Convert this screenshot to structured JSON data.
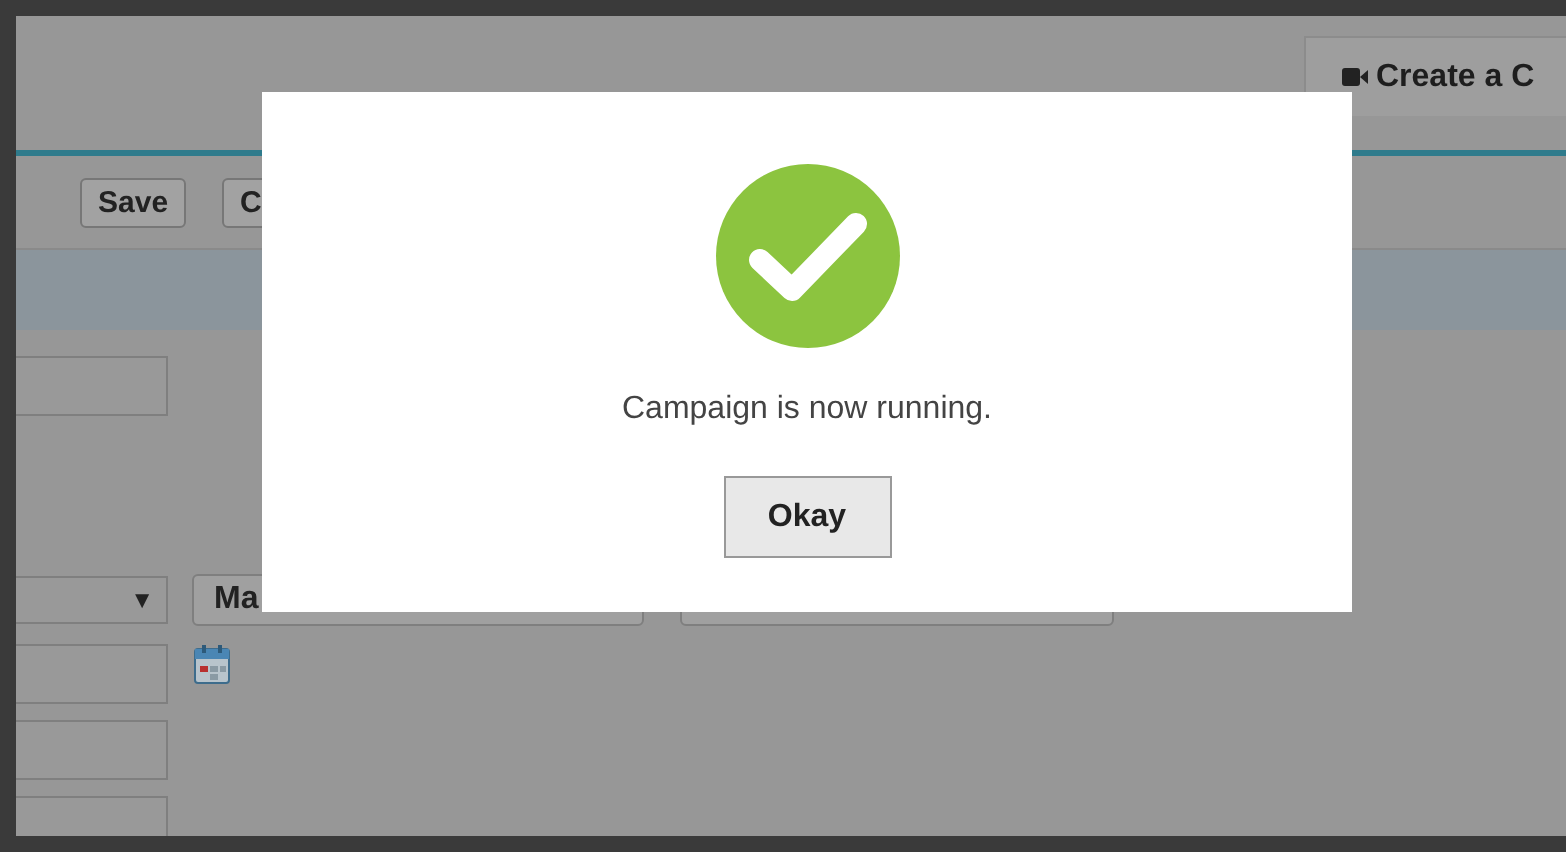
{
  "header": {
    "tab": {
      "label": "Create a C"
    }
  },
  "toolbar": {
    "buttons": [
      "Save",
      "C"
    ]
  },
  "form": {
    "select_arrow": "▼",
    "dropdown_value": "Ma"
  },
  "dialog": {
    "message": "Campaign is now running.",
    "button": "Okay"
  }
}
